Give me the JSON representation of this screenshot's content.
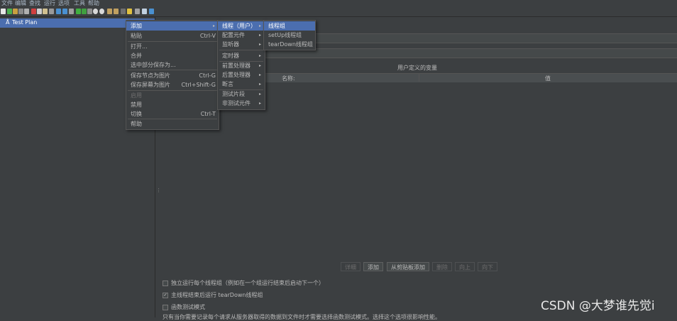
{
  "menubar": [
    "文件",
    "编辑",
    "查找",
    "运行",
    "选项",
    "工具",
    "帮助"
  ],
  "tree": {
    "item_label": "Test Plan"
  },
  "vars": {
    "title": "用户定义的变量",
    "col_name": "名称:",
    "col_value": "值"
  },
  "buttons": {
    "detail": "详细",
    "add": "添加",
    "paste": "从剪贴板添加",
    "delete": "删除",
    "up": "向上",
    "down": "向下"
  },
  "options": {
    "run_each": "独立运行每个线程组（例如在一个组运行结束后启动下一个）",
    "teardown_after": "主线程结束后运行 tearDown线程组",
    "functional": "函数测试模式",
    "note": "只有当你需要记录每个请求从服务器取得的数据到文件时才需要选择函数测试模式。选择这个选项很影响性能。"
  },
  "context_menu": [
    {
      "label": "添加",
      "shortcut": "",
      "submenu": true,
      "selected": true,
      "disabled": false
    },
    {
      "label": "粘贴",
      "shortcut": "Ctrl-V",
      "submenu": false,
      "selected": false,
      "disabled": false
    },
    {
      "label": "打开...",
      "shortcut": "",
      "submenu": false,
      "selected": false,
      "disabled": false
    },
    {
      "label": "合并",
      "shortcut": "",
      "submenu": false,
      "selected": false,
      "disabled": false
    },
    {
      "label": "选中部分保存为...",
      "shortcut": "",
      "submenu": false,
      "selected": false,
      "disabled": false
    },
    {
      "label": "保存节点为图片",
      "shortcut": "Ctrl-G",
      "submenu": false,
      "selected": false,
      "disabled": false
    },
    {
      "label": "保存屏幕为图片",
      "shortcut": "Ctrl+Shift-G",
      "submenu": false,
      "selected": false,
      "disabled": false
    },
    {
      "label": "启用",
      "shortcut": "",
      "submenu": false,
      "selected": false,
      "disabled": true
    },
    {
      "label": "禁用",
      "shortcut": "",
      "submenu": false,
      "selected": false,
      "disabled": false
    },
    {
      "label": "切换",
      "shortcut": "Ctrl-T",
      "submenu": false,
      "selected": false,
      "disabled": false
    },
    {
      "label": "帮助",
      "shortcut": "",
      "submenu": false,
      "selected": false,
      "disabled": false
    }
  ],
  "add_submenu": [
    {
      "label": "线程（用户）",
      "submenu": true,
      "selected": true
    },
    {
      "label": "配置元件",
      "submenu": true,
      "selected": false
    },
    {
      "label": "监听器",
      "submenu": true,
      "selected": false
    },
    {
      "label": "定时器",
      "submenu": true,
      "selected": false
    },
    {
      "label": "前置处理器",
      "submenu": true,
      "selected": false
    },
    {
      "label": "后置处理器",
      "submenu": true,
      "selected": false
    },
    {
      "label": "断言",
      "submenu": true,
      "selected": false
    },
    {
      "label": "测试片段",
      "submenu": true,
      "selected": false
    },
    {
      "label": "非测试元件",
      "submenu": true,
      "selected": false
    }
  ],
  "thread_submenu": [
    {
      "label": "线程组",
      "selected": true
    },
    {
      "label": "setUp线程组",
      "selected": false
    },
    {
      "label": "tearDown线程组",
      "selected": false
    }
  ],
  "watermark": "CSDN @大梦谁先觉i",
  "colors": {
    "selection": "#4b6eaf",
    "background": "#3c3f41"
  }
}
